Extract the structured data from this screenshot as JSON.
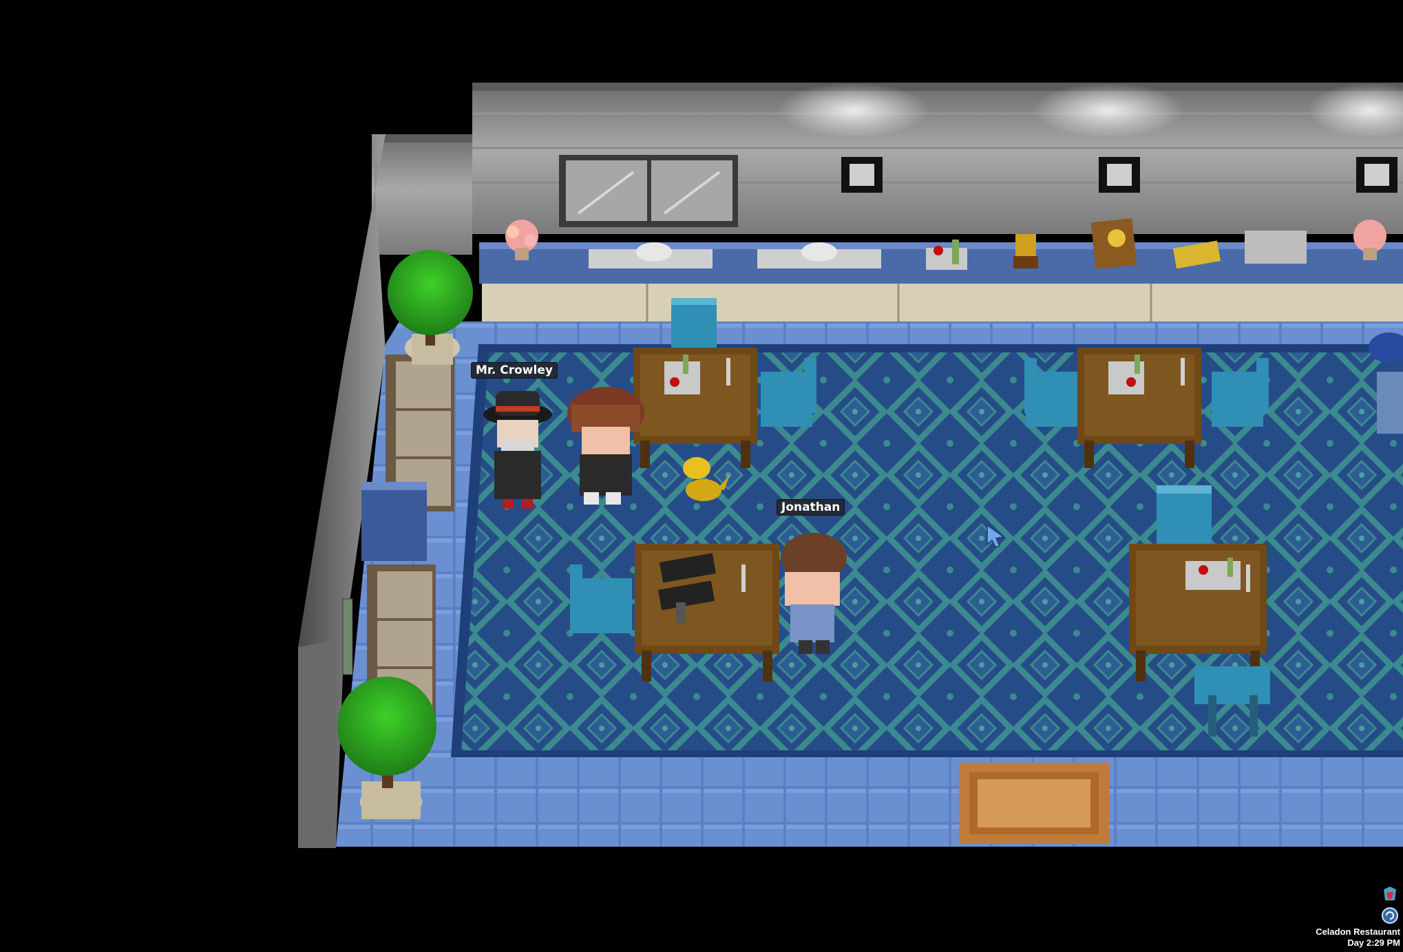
{
  "location": {
    "name": "Celadon Restaurant",
    "time": "Day 2:29 PM"
  },
  "npcs": [
    {
      "name": "Mr. Crowley"
    },
    {
      "name": "Jonathan"
    }
  ],
  "icons": {
    "hud_top": "pokeball-bag-icon",
    "hud_bottom": "refresh-cycle-icon",
    "cursor": "mouse-pointer-icon"
  },
  "colors": {
    "background": "#000000",
    "floor_tile": "#5a7fc4",
    "carpet_base": "#254b86",
    "carpet_pattern": "#3a8a8e",
    "wall": "#8c8c8c",
    "counter": "#4a6aa8",
    "table_wood": "#6e4816",
    "chair": "#2f8fb5",
    "nameplate_bg": "#242a33",
    "nameplate_text": "#ffffff"
  }
}
